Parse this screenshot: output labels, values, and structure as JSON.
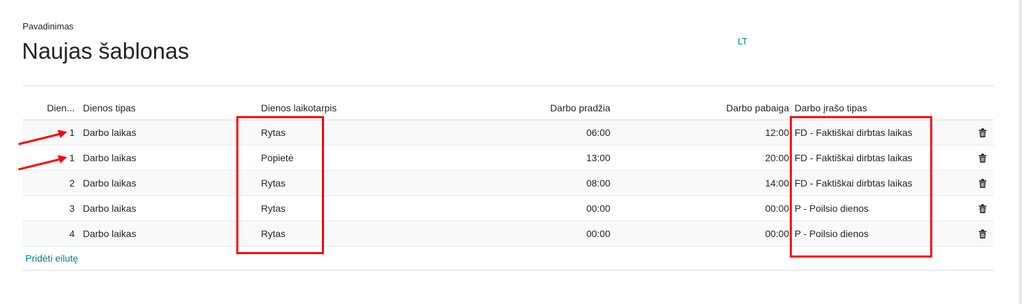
{
  "form": {
    "name_label": "Pavadinimas",
    "name_value": "Naujas šablonas",
    "language_button": "LT"
  },
  "table": {
    "headers": {
      "day": "Dien...",
      "day_type": "Dienos tipas",
      "period": "Dienos laikotarpis",
      "start": "Darbo pradžia",
      "end": "Darbo pabaiga",
      "record_type": "Darbo įrašo tipas"
    },
    "rows": [
      {
        "day": "1",
        "day_type": "Darbo laikas",
        "period": "Rytas",
        "start": "06:00",
        "end": "12:00",
        "record_type": "FD - Faktiškai dirbtas laikas"
      },
      {
        "day": "1",
        "day_type": "Darbo laikas",
        "period": "Popietė",
        "start": "13:00",
        "end": "20:00",
        "record_type": "FD - Faktiškai dirbtas laikas"
      },
      {
        "day": "2",
        "day_type": "Darbo laikas",
        "period": "Rytas",
        "start": "08:00",
        "end": "14:00",
        "record_type": "FD - Faktiškai dirbtas laikas"
      },
      {
        "day": "3",
        "day_type": "Darbo laikas",
        "period": "Rytas",
        "start": "00:00",
        "end": "00:00",
        "record_type": "P - Poilsio dienos"
      },
      {
        "day": "4",
        "day_type": "Darbo laikas",
        "period": "Rytas",
        "start": "00:00",
        "end": "00:00",
        "record_type": "P - Poilsio dienos"
      }
    ],
    "add_line": "Pridėti eilutę"
  },
  "colors": {
    "accent": "#017e84",
    "annotation": "#ff0000",
    "text": "#212529"
  },
  "icons": {
    "delete": "trash-icon"
  }
}
